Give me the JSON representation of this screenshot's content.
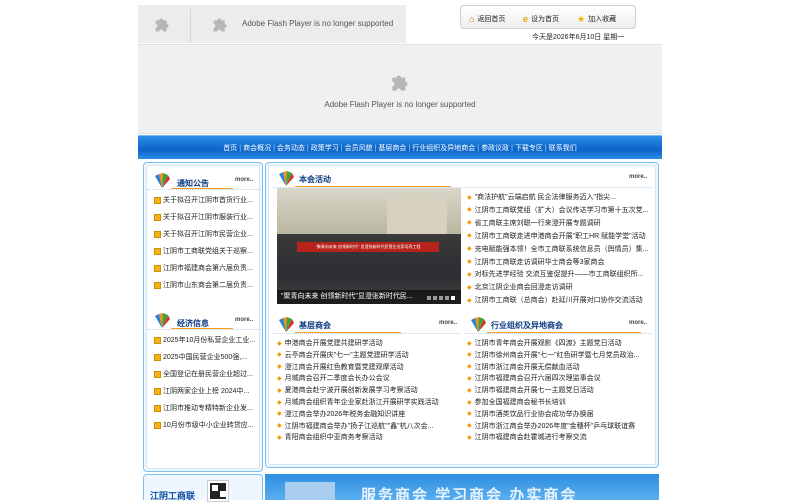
{
  "flash_message": "Adobe Flash Player is no longer supported",
  "quick_links": [
    {
      "label": "返回首页",
      "icon": "home-icon"
    },
    {
      "label": "设为首页",
      "icon": "ie-icon"
    },
    {
      "label": "加入收藏",
      "icon": "star-icon"
    }
  ],
  "date_text": "今天是2026年6月10日 星期一",
  "nav": [
    "首页",
    "商会概况",
    "会务动态",
    "政策学习",
    "会员风貌",
    "基层商会",
    "行业组织及异地商会",
    "参政议政",
    "下载专区",
    "联系我们"
  ],
  "notice": {
    "title": "通知公告",
    "more": "more..",
    "items": [
      "关于拟召开江阴市首货行业...",
      "关于拟召开江阴市服装行业...",
      "关于拟召开江阴市民营企业...",
      "江阴市工商联党组关于巡察...",
      "江阴市福建商会第六届负责...",
      "江阴市山东商会第二届负责..."
    ]
  },
  "economy": {
    "title": "经济信息",
    "more": "more..",
    "items": [
      "2025年10月份私营企业工业...",
      "2025中国民营企业500强,...",
      "全国登记在册民营企业超过...",
      "江阴两家企业上榜 2024中...",
      "江阴市推动专精特新企业发...",
      "10月份市级中小企业转贷应..."
    ]
  },
  "activity": {
    "title": "本会活动",
    "more": "more..",
    "photo_caption": "\"聚青向未来 创领新时代\"显澄张新时代民...",
    "photo_banner": "\"聚青向未来 创领新时代\" 显澄张新时代民营企业家培养工程",
    "items": [
      "\"商法护航\"云端启航 民企法律服务迈入\"指尖...",
      "江阴市工商联党组（扩大）会议传达学习市第十五次党...",
      "省工商联主席刘聪一行来澄开展专题调研",
      "江阴市工商联走进申港商会开展\"职工HR 赋能学堂\"活动",
      "充电赋能强本领！全市工商联系统信息员（舆情员）集...",
      "江阴市工商联走访调研华士商会等3家商会",
      "对标先进学经验 交流互鉴促提升——市工商联组织所...",
      "北京江阴企业商会回澄走访调研",
      "江阴市工商联（总商会）赴延川开展对口协作交流活动"
    ]
  },
  "grassroots": {
    "title": "基层商会",
    "more": "more..",
    "items": [
      "申港商会开展党建共建研学活动",
      "云亭商会开展庆\"七一\"主题党建研学活动",
      "澄江商会开展红色教育暨党建观摩活动",
      "月城商会召开二季度会长办公会议",
      "夏港商会赴宁波开展创新发展学习考察活动",
      "月城商会组织青年企业家赴浙江开展研学实践活动",
      "澄江商会举办2026年税务金融知识讲座",
      "江阴市福建商会举办\"扬子江巡航\"\"鑫\"杭八次会...",
      "青阳商会组织中亚商务考察活动"
    ]
  },
  "industry": {
    "title": "行业组织及异地商会",
    "more": "more..",
    "items": [
      "江阴市青年商会开展观影《四渡》主题党日活动",
      "江阴市徐州商会开展\"七一\"红色研学暨七月党员政治...",
      "江阴市浙江商会开展无偿献血活动",
      "江阴市福建商会召开六届四次理监事会议",
      "江阴市福建商会开展七一主题党日活动",
      "参加全国福建商会秘书长培训",
      "江阴市酒类饮品行业协会成功举办换届",
      "江阴市浙江商会举办2026年度\"金穗杯\"乒乓球联谊赛",
      "江阴市福建商会赴霍城进行考察交流"
    ]
  },
  "bottom": {
    "org_name": "江阴工商联",
    "banner_text": "服务商会 学习商会 办实商会"
  },
  "colors": {
    "nav_blue": "#0a63c8",
    "accent_orange": "#ff9a1f",
    "title_blue": "#0b3a80"
  }
}
